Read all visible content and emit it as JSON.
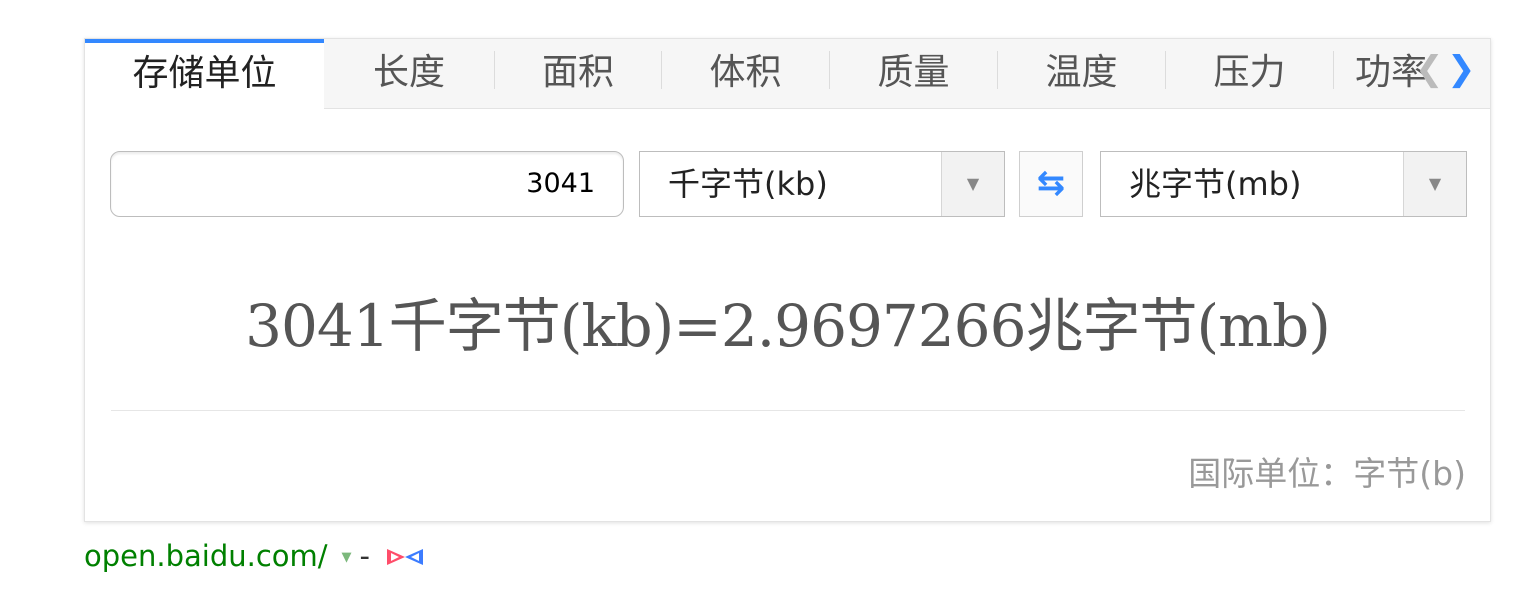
{
  "tabs": [
    {
      "label": "存储单位",
      "active": true
    },
    {
      "label": "长度"
    },
    {
      "label": "面积"
    },
    {
      "label": "体积"
    },
    {
      "label": "质量"
    },
    {
      "label": "温度"
    },
    {
      "label": "压力"
    },
    {
      "label": "功率"
    }
  ],
  "converter": {
    "input_value": "3041",
    "from_unit": "千字节(kb)",
    "to_unit": "兆字节(mb)",
    "result": "3041千字节(kb)=2.9697266兆字节(mb)",
    "si_unit": "国际单位：字节(b)"
  },
  "icons": {
    "tab_prev": "chevron-left-icon",
    "tab_next": "chevron-right-icon",
    "dropdown": "caret-down-icon",
    "swap": "swap-arrows-icon",
    "source": "bowtie-icon"
  },
  "colors": {
    "accent": "#3388ff",
    "url": "#008000"
  },
  "footer": {
    "url": "open.baidu.com/",
    "separator": "-"
  }
}
